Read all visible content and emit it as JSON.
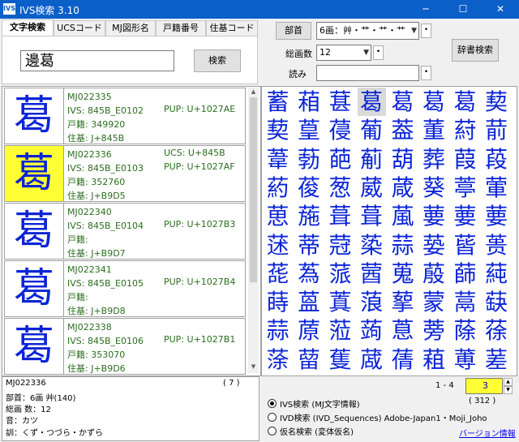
{
  "window": {
    "icon_text": "IVS",
    "title": "IVS検索 3.10",
    "minimize": "─",
    "maximize": "☐",
    "close": "✕"
  },
  "tabs": [
    {
      "label": "文字検索"
    },
    {
      "label": "UCSコード"
    },
    {
      "label": "MJ図形名"
    },
    {
      "label": "戸籍番号"
    },
    {
      "label": "住基コード"
    }
  ],
  "search": {
    "value": "邊葛",
    "button": "検索"
  },
  "radical": {
    "button": "部首",
    "selected": "6画：艸・艹・艹・艹"
  },
  "strokes": {
    "label": "総画数",
    "value": "12"
  },
  "reading": {
    "label": "読み",
    "value": ""
  },
  "dictionary_button": "辞書検索",
  "results": [
    {
      "glyph": "葛",
      "highlight": false,
      "mj": "MJ022335",
      "ucs": "",
      "ivs": "IVS: 845B_E0102",
      "pup": "PUP: U+1027AE",
      "koseki": "戸籍: 349920",
      "juki": "住基: J+845B"
    },
    {
      "glyph": "葛",
      "highlight": true,
      "mj": "MJ022336",
      "ucs": "UCS: U+845B",
      "ivs": "IVS: 845B_E0103",
      "pup": "PUP: U+1027AF",
      "koseki": "戸籍: 352760",
      "juki": "住基: J+B9D5"
    },
    {
      "glyph": "葛",
      "highlight": false,
      "mj": "MJ022340",
      "ucs": "",
      "ivs": "IVS: 845B_E0104",
      "pup": "PUP: U+1027B3",
      "koseki": "戸籍:",
      "juki": "住基: J+B9D7"
    },
    {
      "glyph": "葛",
      "highlight": false,
      "mj": "MJ022341",
      "ucs": "",
      "ivs": "IVS: 845B_E0105",
      "pup": "PUP: U+1027B4",
      "koseki": "戸籍:",
      "juki": "住基: J+B9D8"
    },
    {
      "glyph": "葛",
      "highlight": false,
      "mj": "MJ022338",
      "ucs": "",
      "ivs": "IVS: 845B_E0106",
      "pup": "PUP: U+1027B1",
      "koseki": "戸籍: 353070",
      "juki": "住基: J+B9D6"
    }
  ],
  "kanji_grid": {
    "rows": [
      [
        "蓄",
        "葙",
        "葚",
        "葛",
        "葛",
        "葛",
        "葛",
        "葜"
      ],
      [
        "葜",
        "葟",
        "葠",
        "葡",
        "葢",
        "董",
        "葤",
        "葥"
      ],
      [
        "葦",
        "葧",
        "葩",
        "葪",
        "葫",
        "葬",
        "葭",
        "葮"
      ],
      [
        "葯",
        "葰",
        "葱",
        "葳",
        "葴",
        "葵",
        "葶",
        "葷"
      ],
      [
        "葸",
        "葹",
        "葺",
        "葺",
        "葻",
        "葽",
        "葽",
        "葽"
      ],
      [
        "蒁",
        "蒂",
        "蒄",
        "蒅",
        "蒜",
        "蒆",
        "蒈",
        "蒉"
      ],
      [
        "蒊",
        "蒍",
        "蒎",
        "蒏",
        "蒐",
        "蒑",
        "蒒",
        "蒓"
      ],
      [
        "蒔",
        "蒕",
        "蒖",
        "蒗",
        "蒘",
        "蒙",
        "蒚",
        "蒛"
      ],
      [
        "蒜",
        "蒝",
        "蒞",
        "蒟",
        "蒠",
        "蒡",
        "蒢",
        "蒣"
      ],
      [
        "蒤",
        "蒥",
        "蒦",
        "蒧",
        "蒨",
        "蒩",
        "蒪",
        "蒫"
      ]
    ],
    "selected_row": 0,
    "selected_col": 3
  },
  "details": {
    "mj": "MJ022336",
    "count": "( 7 )",
    "radical": "部首：6画 艸(140)",
    "total_strokes": "総画 数：12",
    "on_reading": "音：カツ",
    "kun_reading": "訓：くず・つづら・かずら"
  },
  "pager": {
    "range": "1 - 4",
    "value": "3",
    "total": "( 312 )"
  },
  "modes": [
    {
      "label": "IVS検索 (MJ文字情報)",
      "checked": true
    },
    {
      "label": "IVD検索 (IVD_Sequences) Adobe-Japan1・Moji_Joho",
      "checked": false
    },
    {
      "label": "仮名検索 (変体仮名)",
      "checked": false
    }
  ],
  "version_link": "バージョン情報",
  "colors": {
    "titlebar": "#0a5fc9",
    "glyph": "#0b24d6",
    "info_text": "#2b6e1f",
    "highlight": "#ffff33"
  }
}
